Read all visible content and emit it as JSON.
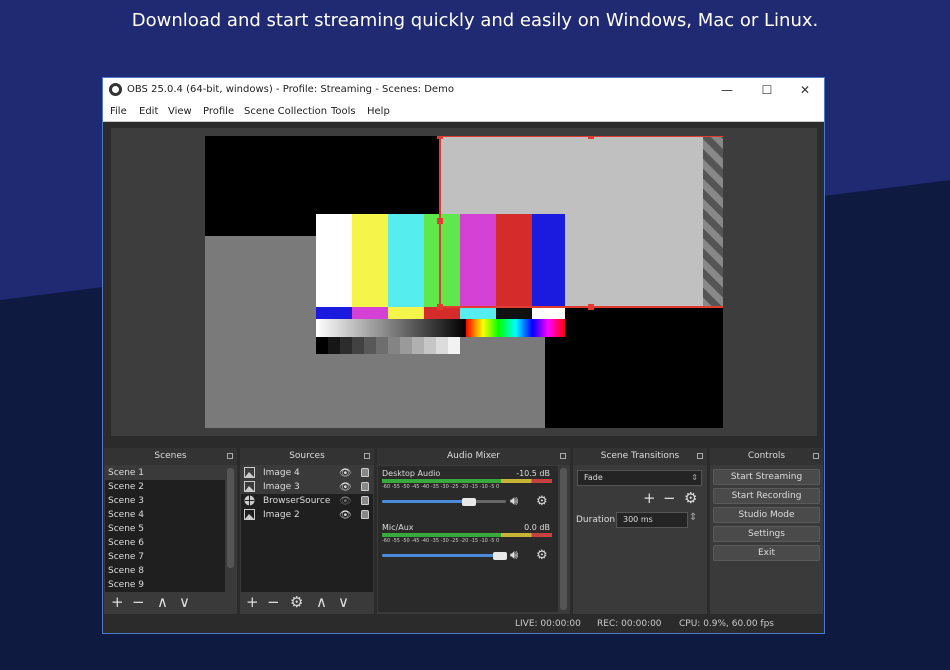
{
  "headline": "Download and start streaming quickly and easily on Windows, Mac or Linux.",
  "window": {
    "title": "OBS 25.0.4 (64-bit, windows) - Profile: Streaming - Scenes: Demo",
    "minimize": "—",
    "maximize": "☐",
    "close": "✕"
  },
  "menu": [
    "File",
    "Edit",
    "View",
    "Profile",
    "Scene Collection",
    "Tools",
    "Help"
  ],
  "scenes": {
    "title": "Scenes",
    "items": [
      "Scene 1",
      "Scene 2",
      "Scene 3",
      "Scene 4",
      "Scene 5",
      "Scene 6",
      "Scene 7",
      "Scene 8",
      "Scene 9"
    ]
  },
  "sources": {
    "title": "Sources",
    "items": [
      {
        "name": "Image 4",
        "icon": "image-icon"
      },
      {
        "name": "Image 3",
        "icon": "image-icon"
      },
      {
        "name": "BrowserSource",
        "icon": "globe-icon"
      },
      {
        "name": "Image 2",
        "icon": "image-icon"
      }
    ]
  },
  "mixer": {
    "title": "Audio Mixer",
    "channels": [
      {
        "name": "Desktop Audio",
        "db": "-10.5 dB",
        "volume": 0.7
      },
      {
        "name": "Mic/Aux",
        "db": "0.0 dB",
        "volume": 0.95
      }
    ],
    "scale": [
      "-60",
      "-55",
      "-50",
      "-45",
      "-40",
      "-35",
      "-30",
      "-25",
      "-20",
      "-15",
      "-10",
      "-5",
      "0"
    ]
  },
  "transitions": {
    "title": "Scene Transitions",
    "selected": "Fade",
    "duration_label": "Duration",
    "duration_value": "300 ms"
  },
  "controls": {
    "title": "Controls",
    "buttons": [
      "Start Streaming",
      "Start Recording",
      "Studio Mode",
      "Settings",
      "Exit"
    ]
  },
  "status": {
    "live": "LIVE: 00:00:00",
    "rec": "REC: 00:00:00",
    "cpu": "CPU: 0.9%, 60.00 fps"
  },
  "colors": {
    "accent": "#4a7ac8",
    "selection": "#e03c31",
    "slider": "#4a8ad8"
  }
}
